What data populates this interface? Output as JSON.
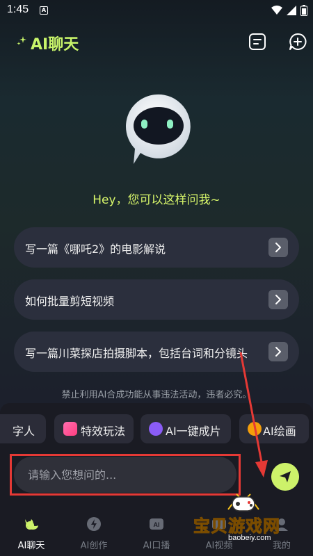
{
  "status": {
    "time": "1:45",
    "app_badge": "A"
  },
  "header": {
    "title": "AI聊天"
  },
  "hero": {
    "greeting": "Hey，您可以这样问我~"
  },
  "prompts": [
    {
      "text": "写一篇《哪吒2》的电影解说"
    },
    {
      "text": "如何批量剪短视频"
    },
    {
      "text": "写一篇川菜探店拍摄脚本，包括台词和分镜头"
    }
  ],
  "disclaimer": "禁止利用AI合成功能从事违法活动，违者必究。",
  "chips": [
    {
      "label": "字人"
    },
    {
      "label": "特效玩法"
    },
    {
      "label": "AI一键成片"
    },
    {
      "label": "AI绘画"
    }
  ],
  "input": {
    "placeholder": "请输入您想问的..."
  },
  "tabs": [
    {
      "label": "AI聊天"
    },
    {
      "label": "AI创作"
    },
    {
      "label": "AI口播"
    },
    {
      "label": "AI视频"
    },
    {
      "label": "我的"
    }
  ],
  "watermark": {
    "text": "宝贝游戏网",
    "url": "baobeiy.com"
  },
  "colors": {
    "accent": "#cdf26a",
    "bg": "#1c1d26",
    "card": "#2b2f3d",
    "highlight": "#e53935"
  }
}
